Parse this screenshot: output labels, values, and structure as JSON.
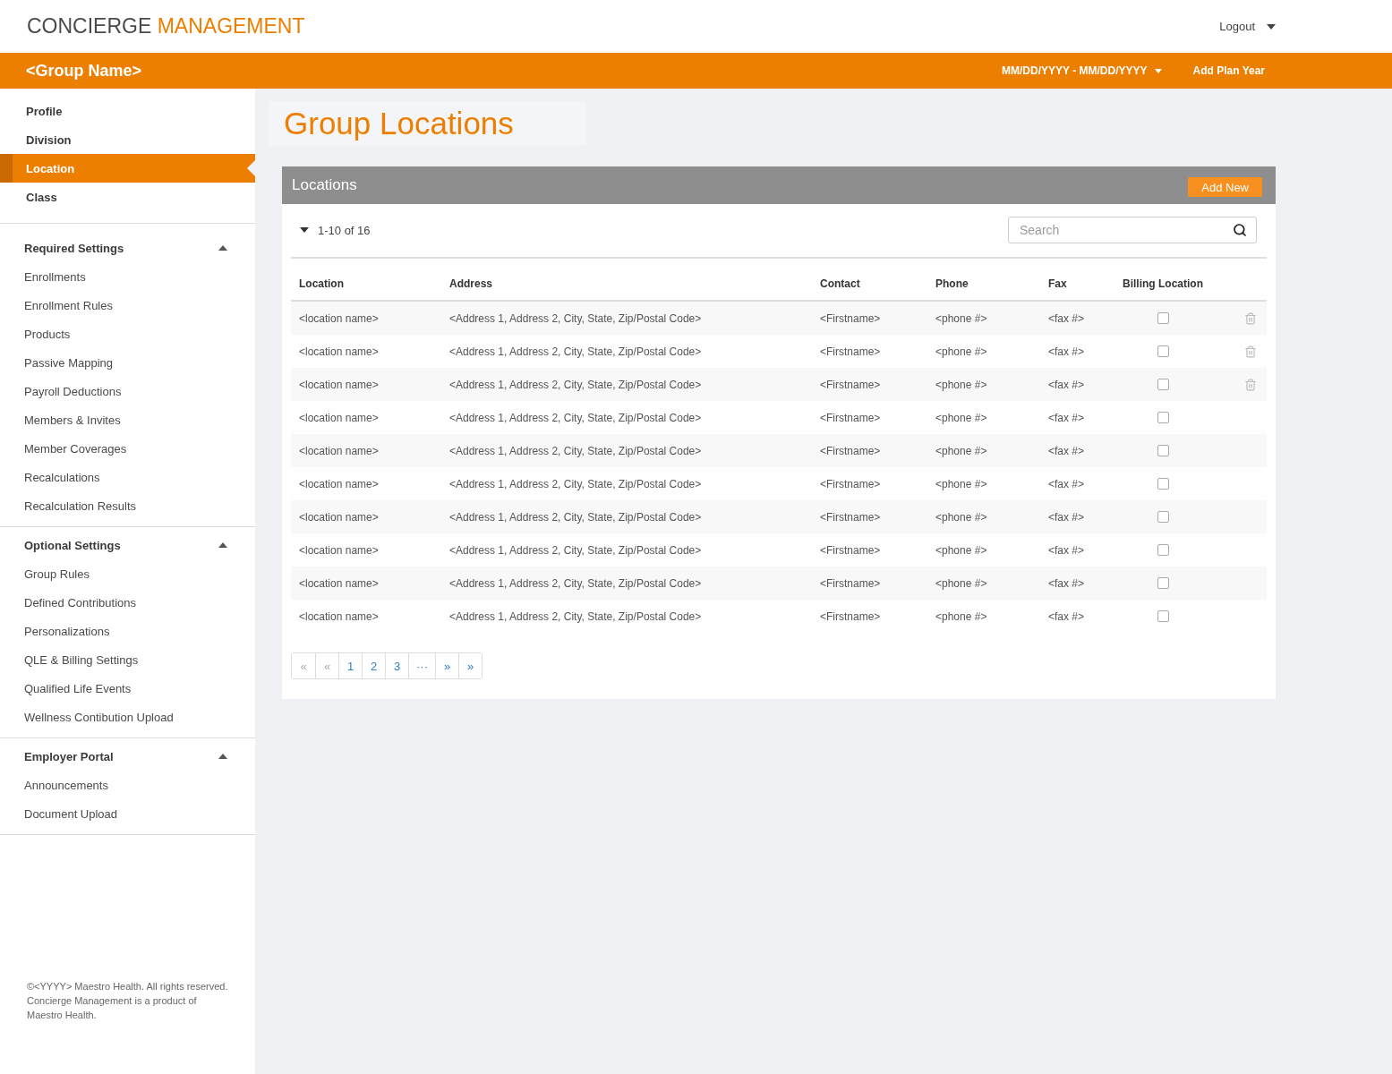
{
  "header": {
    "logo": {
      "primary": "CONCIERGE",
      "accent": "MANAGEMENT"
    },
    "user_menu": "Logout"
  },
  "group_bar": {
    "group_name": "<Group Name>",
    "plan_year": "MM/DD/YYYY - MM/DD/YYYY",
    "add_plan_year": "Add Plan Year"
  },
  "sidebar": {
    "items": [
      {
        "label": "Profile",
        "selected": false
      },
      {
        "label": "Division",
        "selected": false
      },
      {
        "label": "Location",
        "selected": true
      },
      {
        "label": "Class",
        "selected": false
      }
    ],
    "sections": [
      {
        "title": "Required Settings",
        "expanded": true,
        "items": [
          {
            "label": "Enrollments",
            "selected": false
          },
          {
            "label": "Enrollment Rules",
            "selected": false
          },
          {
            "label": "Products",
            "selected": false
          },
          {
            "label": "Passive Mapping",
            "selected": false
          },
          {
            "label": "Payroll Deductions",
            "selected": false
          },
          {
            "label": "Members & Invites",
            "selected": false
          },
          {
            "label": "Member Coverages",
            "selected": false
          },
          {
            "label": "Recalculations",
            "selected": false
          },
          {
            "label": "Recalculation Results",
            "selected": false
          }
        ]
      },
      {
        "title": "Optional Settings",
        "expanded": true,
        "items": [
          {
            "label": "Group Rules",
            "selected": false
          },
          {
            "label": "Defined Contributions",
            "selected": false
          },
          {
            "label": "Personalizations",
            "selected": false
          },
          {
            "label": "QLE & Billing Settings",
            "selected": false
          },
          {
            "label": "Qualified Life Events",
            "selected": false
          },
          {
            "label": "Wellness Contibution Upload",
            "selected": false
          }
        ]
      },
      {
        "title": "Employer Portal",
        "expanded": true,
        "items": [
          {
            "label": "Announcements",
            "selected": false
          },
          {
            "label": "Document Upload",
            "selected": false
          }
        ]
      }
    ],
    "footer": {
      "lines": [
        "©<YYYY> Maestro Health. All rights reserved.",
        "Concierge Management is a product of",
        "Maestro Health."
      ]
    }
  },
  "page_title": "Group Locations",
  "panel": {
    "title": "Locations",
    "add_button": "Add New",
    "range": "1-10 of 16",
    "search": {
      "placeholder": "Search"
    },
    "table": {
      "columns": [
        "Location",
        "Address",
        "Contact",
        "Phone",
        "Fax",
        "Billing Location"
      ],
      "rows": [
        {
          "location": "<location name>",
          "address": "<Address 1, Address 2, City, State, Zip/Postal Code>",
          "contact": "<Firstname>",
          "phone": "<phone #>",
          "fax": "<fax #>",
          "billing_location": false,
          "deletable": true
        },
        {
          "location": "<location name>",
          "address": "<Address 1, Address 2, City, State, Zip/Postal Code>",
          "contact": "<Firstname>",
          "phone": "<phone #>",
          "fax": "<fax #>",
          "billing_location": false,
          "deletable": true
        },
        {
          "location": "<location name>",
          "address": "<Address 1, Address 2, City, State, Zip/Postal Code>",
          "contact": "<Firstname>",
          "phone": "<phone #>",
          "fax": "<fax #>",
          "billing_location": false,
          "deletable": true
        },
        {
          "location": "<location name>",
          "address": "<Address 1, Address 2, City, State, Zip/Postal Code>",
          "contact": "<Firstname>",
          "phone": "<phone #>",
          "fax": "<fax #>",
          "billing_location": false,
          "deletable": false
        },
        {
          "location": "<location name>",
          "address": "<Address 1, Address 2, City, State, Zip/Postal Code>",
          "contact": "<Firstname>",
          "phone": "<phone #>",
          "fax": "<fax #>",
          "billing_location": false,
          "deletable": false
        },
        {
          "location": "<location name>",
          "address": "<Address 1, Address 2, City, State, Zip/Postal Code>",
          "contact": "<Firstname>",
          "phone": "<phone #>",
          "fax": "<fax #>",
          "billing_location": false,
          "deletable": false
        },
        {
          "location": "<location name>",
          "address": "<Address 1, Address 2, City, State, Zip/Postal Code>",
          "contact": "<Firstname>",
          "phone": "<phone #>",
          "fax": "<fax #>",
          "billing_location": false,
          "deletable": false
        },
        {
          "location": "<location name>",
          "address": "<Address 1, Address 2, City, State, Zip/Postal Code>",
          "contact": "<Firstname>",
          "phone": "<phone #>",
          "fax": "<fax #>",
          "billing_location": false,
          "deletable": false
        },
        {
          "location": "<location name>",
          "address": "<Address 1, Address 2, City, State, Zip/Postal Code>",
          "contact": "<Firstname>",
          "phone": "<phone #>",
          "fax": "<fax #>",
          "billing_location": false,
          "deletable": false
        },
        {
          "location": "<location name>",
          "address": "<Address 1, Address 2, City, State, Zip/Postal Code>",
          "contact": "<Firstname>",
          "phone": "<phone #>",
          "fax": "<fax #>",
          "billing_location": false,
          "deletable": false
        }
      ]
    },
    "pagination": [
      {
        "label": "«",
        "disabled": true
      },
      {
        "label": "«",
        "disabled": true
      },
      {
        "label": "1",
        "disabled": false
      },
      {
        "label": "2",
        "disabled": false
      },
      {
        "label": "3",
        "disabled": false
      },
      {
        "label": "···",
        "disabled": false
      },
      {
        "label": "»",
        "disabled": false
      },
      {
        "label": "»",
        "disabled": false
      }
    ]
  }
}
